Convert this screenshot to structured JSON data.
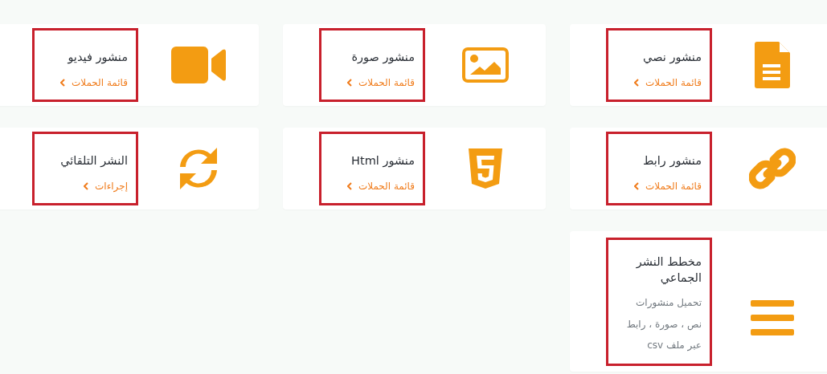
{
  "cards": [
    {
      "kind": "link",
      "title": "منشور نصي",
      "link": "قائمة الحملات"
    },
    {
      "kind": "link",
      "title": "منشور صورة",
      "link": "قائمة الحملات"
    },
    {
      "kind": "link",
      "title": "منشور فيديو",
      "link": "قائمة الحملات"
    },
    {
      "kind": "link",
      "title": "منشور رابط",
      "link": "قائمة الحملات"
    },
    {
      "kind": "link",
      "title": "منشور Html",
      "link": "قائمة الحملات"
    },
    {
      "kind": "link",
      "title": "النشر التلقائي",
      "link": "إجراءات"
    },
    {
      "kind": "description",
      "title": "مخطط النشر الجماعي",
      "description_lines": [
        "تحميل منشورات",
        "نص ، صورة ، رابط",
        "عبر ملف csv"
      ]
    }
  ]
}
